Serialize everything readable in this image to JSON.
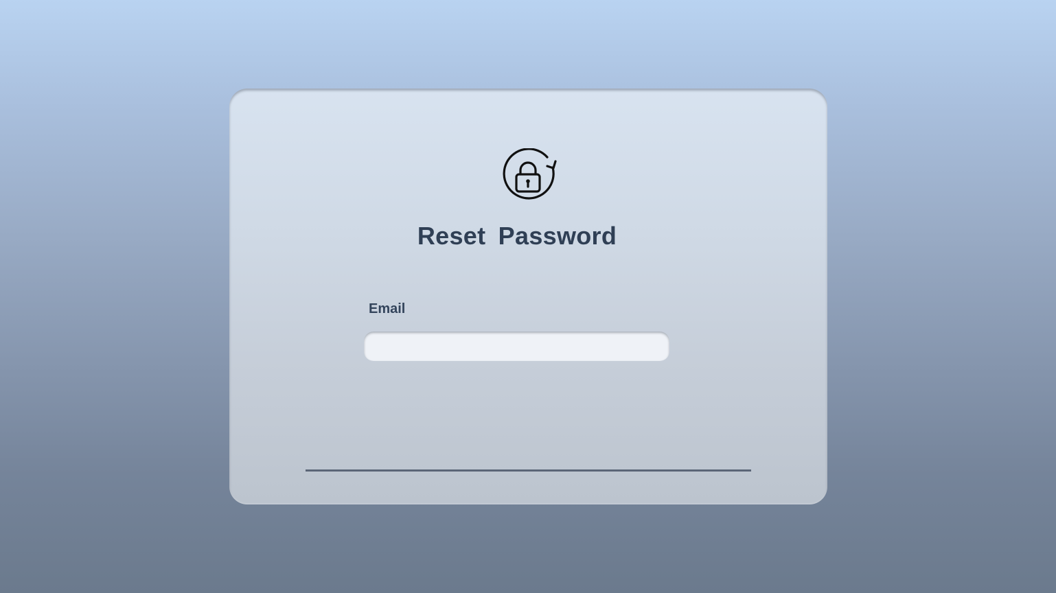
{
  "page": {
    "title": "Reset  Password",
    "icon": "lock-refresh-icon"
  },
  "form": {
    "email_label": "Email",
    "email_value": "",
    "email_placeholder": ""
  },
  "colors": {
    "text_primary": "#2f3f55",
    "divider": "#5b6677",
    "input_bg": "#eff2f7"
  }
}
